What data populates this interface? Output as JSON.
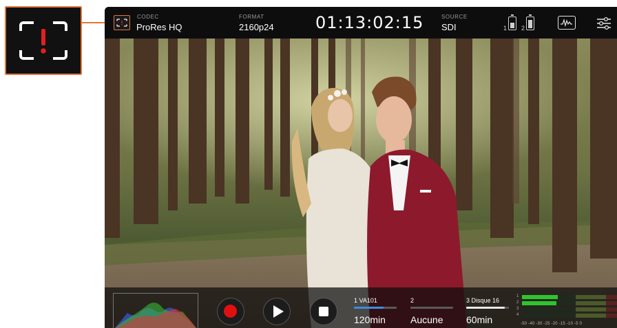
{
  "callout": {
    "icon": "media-warning-icon",
    "accent": "#e0743a"
  },
  "header": {
    "codec_label": "CODEC",
    "codec_value": "ProRes HQ",
    "format_label": "FORMAT",
    "format_value": "2160p24",
    "timecode": "01:13:02:15",
    "source_label": "SOURCE",
    "source_value": "SDI",
    "batteries": [
      {
        "num": "1",
        "level": 0.55
      },
      {
        "num": "2",
        "level": 0.85
      }
    ],
    "icons": [
      "scope-icon",
      "settings-icon"
    ]
  },
  "hud": {
    "slots": [
      {
        "label": "1  VA101",
        "value": "120min",
        "fill": 0.7,
        "color": "#3a8fe0"
      },
      {
        "label": "2",
        "value": "Aucune",
        "fill": 0,
        "color": "#5a5a5a"
      },
      {
        "label": "3  Disque 16",
        "value": "60min",
        "fill": 0.9,
        "color": "#e8e8e8"
      }
    ],
    "meter_channels": [
      "1",
      "2",
      "3",
      "4"
    ],
    "meter_scale": "-50 -40  -30 -25 -20  -15  -10  -5  0",
    "record_color": "#e01010"
  }
}
